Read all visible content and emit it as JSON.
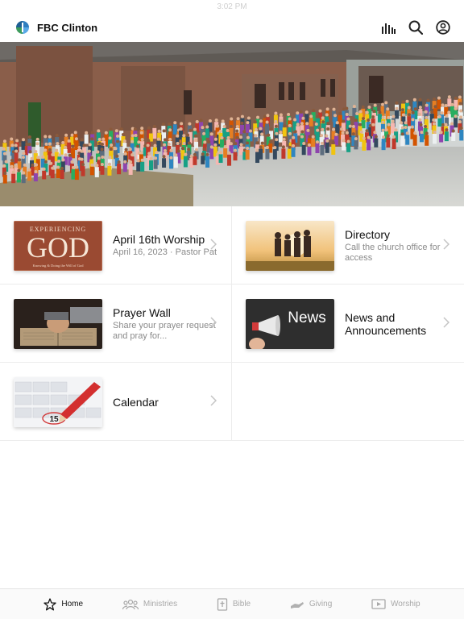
{
  "status_bar": {
    "time": "3:02 PM"
  },
  "app": {
    "title": "FBC Clinton"
  },
  "header_icons": [
    "audio-bars-icon",
    "search-icon",
    "profile-icon"
  ],
  "grid": {
    "worship": {
      "title": "April 16th Worship",
      "subtitle": "April 16, 2023 · Pastor Pat",
      "thumb_line1": "EXPERIENCING",
      "thumb_line2": "GOD",
      "thumb_line3": "Knowing & Doing the Will of God"
    },
    "directory": {
      "title": "Directory",
      "subtitle": "Call the church office for access"
    },
    "prayer": {
      "title": "Prayer Wall",
      "subtitle": "Share your prayer request and pray for..."
    },
    "news": {
      "title": "News and Announcements",
      "subtitle": "",
      "thumb_text": "News"
    },
    "calendar": {
      "title": "Calendar",
      "subtitle": "",
      "thumb_number": "15"
    }
  },
  "tabs": [
    {
      "label": "Home",
      "icon": "star-icon",
      "active": true
    },
    {
      "label": "Ministries",
      "icon": "people-icon",
      "active": false
    },
    {
      "label": "Bible",
      "icon": "bible-icon",
      "active": false
    },
    {
      "label": "Giving",
      "icon": "hand-giving-icon",
      "active": false
    },
    {
      "label": "Worship",
      "icon": "play-screen-icon",
      "active": false
    }
  ],
  "colors": {
    "accent": "#111111",
    "inactive": "#a8a8a8",
    "divider": "#ececec"
  }
}
